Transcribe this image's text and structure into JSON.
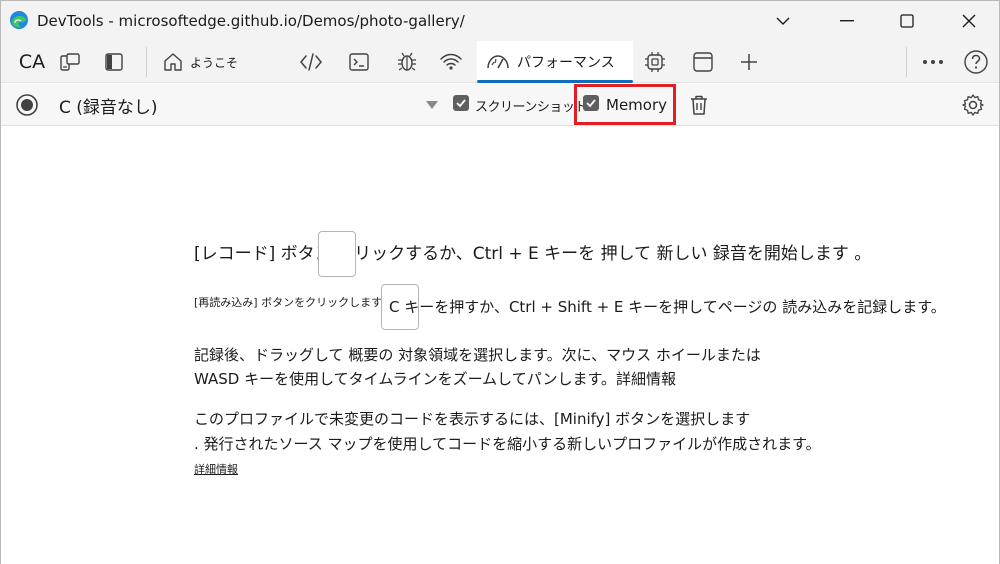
{
  "window": {
    "title": "DevTools - microsoftedge.github.io/Demos/photo-gallery/"
  },
  "tabbar": {
    "ca_label": "CA",
    "tabs": [
      {
        "label": "ようこそ",
        "icon": "home-icon"
      },
      {
        "label": "",
        "icon": "elements-icon"
      },
      {
        "label": "",
        "icon": "console-icon"
      },
      {
        "label": "",
        "icon": "bug-icon"
      },
      {
        "label": "",
        "icon": "wifi-icon"
      },
      {
        "label": "パフォーマンス",
        "icon": "performance-icon",
        "selected": true
      },
      {
        "label": "",
        "icon": "memory-chip-icon"
      },
      {
        "label": "",
        "icon": "application-icon"
      }
    ]
  },
  "toolbar": {
    "profile_label": "C (録音なし)",
    "screenshots_label": "スクリーンショット",
    "screenshots_checked": true,
    "memory_label": "Memory",
    "memory_checked": true
  },
  "content": {
    "line1_prefix": "[レコード] ボタン",
    "line1_at": "@",
    "line1_suffix": "をクリックするか、Ctrl + E キーを 押して 新しい 録音を開始します 。",
    "line2_prefix": "[再読み込み] ボタンをクリックします",
    "line2_suffix": "C キーを押すか、Ctrl + Shift + E キーを押してページの 読み込みを記録します。",
    "line3": "記録後、ドラッグして 概要の 対象領域を選択します。次に、マウス ホイールまたは",
    "line4": "WASD キーを使用してタイムラインをズームしてパンします。詳細情報",
    "line5": "このプロファイルで未変更のコードを表示するには、[Minify] ボタンを選択します",
    "line6": ". 発行されたソース マップを使用してコードを縮小する新しいプロファイルが作成されます。",
    "learn_more": "詳細情報"
  },
  "colors": {
    "accent": "#0f6cbd",
    "highlight": "#e31f26"
  }
}
